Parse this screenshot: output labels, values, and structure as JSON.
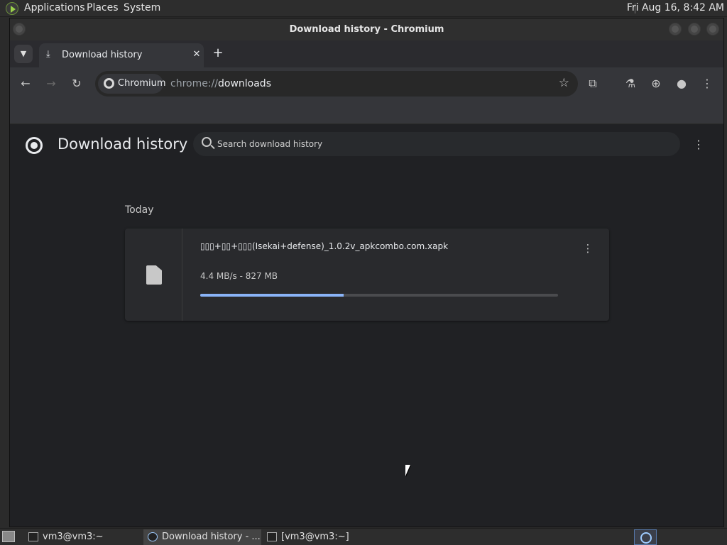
{
  "top_panel": {
    "menus": [
      "Applications",
      "Places",
      "System"
    ],
    "clock": "Fri Aug 16,  8:42 AM"
  },
  "window": {
    "title": "Download history - Chromium"
  },
  "tabs": [
    {
      "title": "Download history",
      "icon": "download-icon",
      "active": true
    }
  ],
  "toolbar": {
    "site_chip_label": "Chromium",
    "url_scheme": "chrome://",
    "url_host": "downloads"
  },
  "page": {
    "title": "Download history",
    "search_placeholder": "Search download history",
    "date_header": "Today",
    "downloads": [
      {
        "file_name": "▯▯▯+▯▯+▯▯▯(Isekai+defense)_1.0.2v_apkcombo.com.xapk",
        "progress_text": "4.4 MB/s - 827 MB",
        "progress_fraction": 0.4
      }
    ]
  },
  "taskbar": {
    "tasks": [
      {
        "label": "vm3@vm3:~",
        "active": false
      },
      {
        "label": "Download history - ...",
        "active": true
      },
      {
        "label": "[vm3@vm3:~]",
        "active": false
      }
    ]
  },
  "colors": {
    "accent": "#8ab4f8",
    "page_bg": "#202124",
    "card_bg": "#292a2d"
  }
}
